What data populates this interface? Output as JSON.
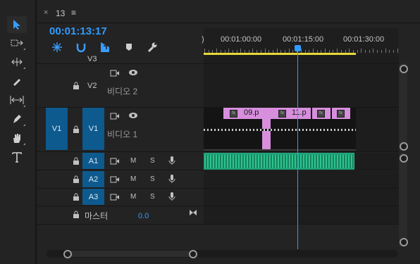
{
  "tab": {
    "close": "×",
    "name": "13",
    "menu": "≡"
  },
  "timecode": "00:01:13:17",
  "ruler": {
    "labels": [
      "00:01:00:00",
      "00:01:15:00",
      "00:01:30:00"
    ],
    "start_label": ")"
  },
  "tracks": {
    "v3": {
      "label": "V3"
    },
    "v2": {
      "label": "V2",
      "name": "비디오 2"
    },
    "v1": {
      "label": "V1",
      "source": "V1",
      "name": "비디오 1"
    },
    "audio": [
      {
        "label": "A1",
        "m": "M",
        "s": "S"
      },
      {
        "label": "A2",
        "m": "M",
        "s": "S"
      },
      {
        "label": "A3",
        "m": "M",
        "s": "S"
      }
    ],
    "master": {
      "name": "마스터",
      "value": "0.0"
    }
  },
  "clips": [
    {
      "label": "09.p",
      "fx": "fx"
    },
    {
      "label": "11.p",
      "fx": "fx"
    },
    {
      "label": "",
      "fx": "fx"
    },
    {
      "label": "",
      "fx": "fx"
    }
  ],
  "colors": {
    "accent": "#2f9cff",
    "clip": "#d78fdd",
    "audio": "#1fa37a",
    "source": "#0d5a8e",
    "workarea": "#e8d83a"
  }
}
